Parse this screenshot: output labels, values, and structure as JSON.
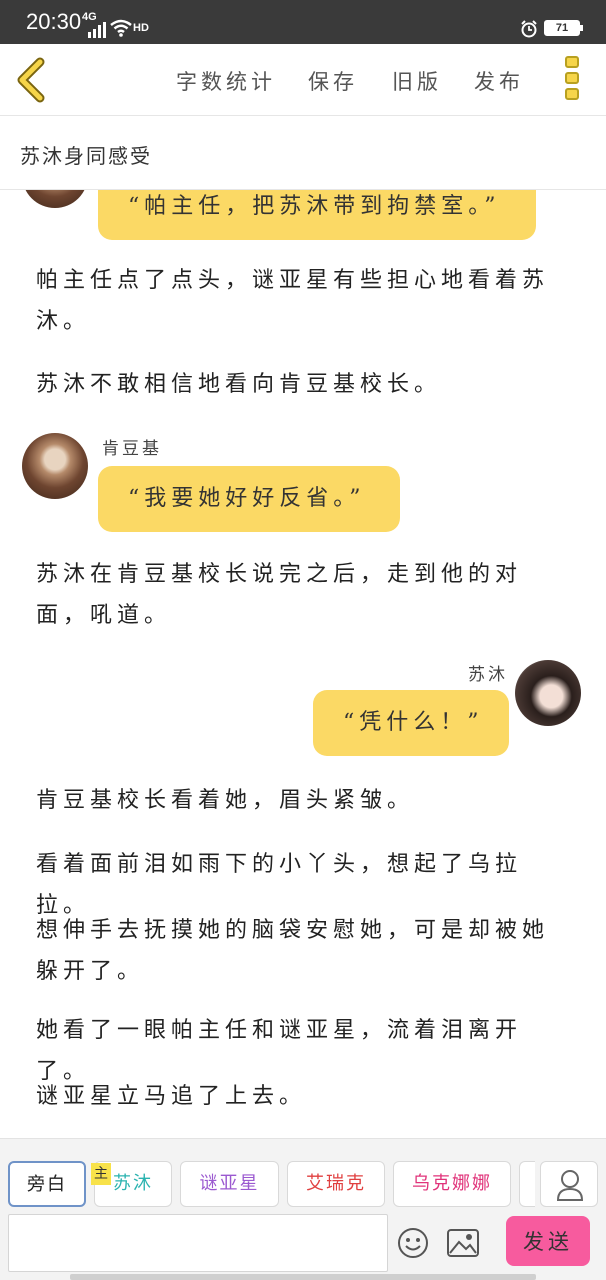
{
  "status_bar": {
    "time": "20:30",
    "network": "4G",
    "hd": "HD",
    "battery": "71"
  },
  "toolbar": {
    "back_icon": "chevron-left-icon",
    "word_count": "字数统计",
    "save": "保存",
    "old_version": "旧版",
    "publish": "发布",
    "more_icon": "more-vertical-icon"
  },
  "story": {
    "title": "苏沐身同感受"
  },
  "messages": [
    {
      "type": "bubble",
      "speaker": "",
      "text": "“帕主任，把苏沐带到拘禁室。”"
    },
    {
      "type": "narration",
      "text": "帕主任点了点头，谜亚星有些担心地看着苏沐。"
    },
    {
      "type": "narration",
      "text": "苏沐不敢相信地看向肯豆基校长。"
    },
    {
      "type": "bubble",
      "speaker": "肯豆基",
      "text": "“我要她好好反省。”"
    },
    {
      "type": "narration",
      "text": "苏沐在肯豆基校长说完之后，走到他的对面，吼道。"
    },
    {
      "type": "bubble",
      "speaker": "苏沐",
      "text": "“凭什么！”"
    },
    {
      "type": "narration",
      "text": "肯豆基校长看着她，眉头紧皱。"
    },
    {
      "type": "narration",
      "text": "看着面前泪如雨下的小丫头，想起了乌拉拉。"
    },
    {
      "type": "narration",
      "text": "想伸手去抚摸她的脑袋安慰她，可是却被她躲开了。"
    },
    {
      "type": "narration",
      "text": "她看了一眼帕主任和谜亚星，流着泪离开了。"
    },
    {
      "type": "narration",
      "text": "谜亚星立马追了上去。"
    }
  ],
  "roles": {
    "main_badge": "主",
    "chips": [
      {
        "label": "旁白",
        "color": "#555555"
      },
      {
        "label": "苏沐",
        "color": "#2bb3b0"
      },
      {
        "label": "谜亚星",
        "color": "#9b59d0"
      },
      {
        "label": "艾瑞克",
        "color": "#e04040"
      },
      {
        "label": "乌克娜娜",
        "color": "#e0337a"
      }
    ],
    "user_icon": "user-icon"
  },
  "composer": {
    "input_value": "",
    "emoji_icon": "smiley-icon",
    "image_icon": "image-icon",
    "send_label": "发送"
  }
}
